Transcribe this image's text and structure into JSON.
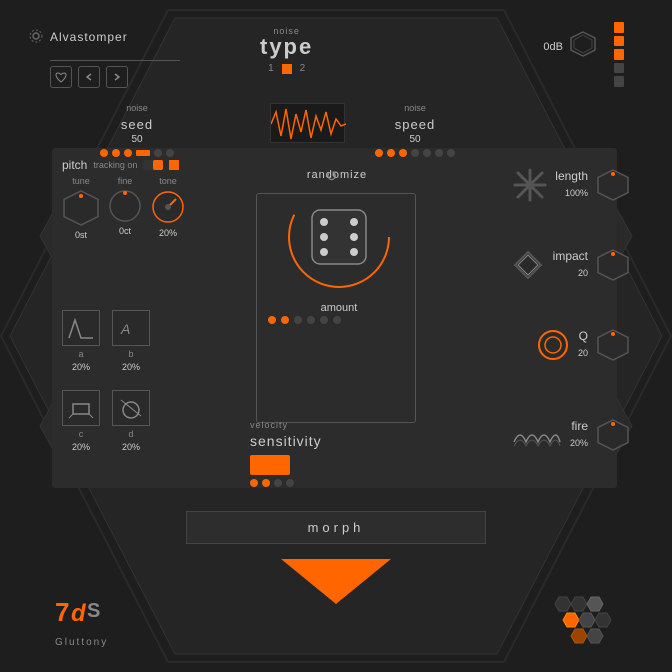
{
  "app": {
    "brand": "Alvastomper",
    "plugin_name": "Gluttony",
    "company": "7dS"
  },
  "header": {
    "db_value": "0dB",
    "noise_type_label": "noise",
    "noise_type_title": "type",
    "noise_btn_1": "1",
    "noise_btn_2": "2"
  },
  "noise_seed": {
    "label": "noise",
    "title": "seed",
    "value": "50"
  },
  "noise_speed": {
    "label": "noise",
    "title": "speed",
    "value": "50"
  },
  "pitch": {
    "section_title": "pitch",
    "tracking_label": "tracking on",
    "tune_label": "tune",
    "fine_label": "fine",
    "tone_label": "tone",
    "tune_value": "0st",
    "fine_value": "0ct",
    "tone_value": "20%"
  },
  "envelopes": {
    "a_label": "a",
    "b_label": "b",
    "c_label": "c",
    "d_label": "d",
    "a_value": "20%",
    "b_value": "20%",
    "c_value": "20%",
    "d_value": "20%"
  },
  "randomize": {
    "title": "randomize",
    "amount_label": "amount"
  },
  "params": {
    "length_label": "length",
    "length_value": "100%",
    "impact_label": "impact",
    "impact_value": "20",
    "q_label": "Q",
    "q_value": "20",
    "fire_label": "fire",
    "fire_value": "20%"
  },
  "velocity": {
    "label": "velocity",
    "title": "sensitivity"
  },
  "morph": {
    "label": "morph"
  },
  "logo": {
    "text": "7dS",
    "subtitle": "Gluttony"
  }
}
